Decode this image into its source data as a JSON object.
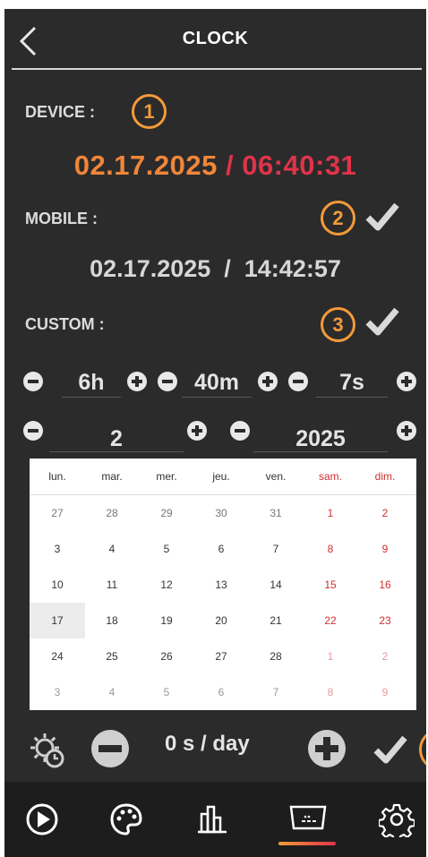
{
  "header": {
    "title": "CLOCK"
  },
  "device": {
    "label": "DEVICE :",
    "marker": "1",
    "date": "02.17.2025",
    "sep": " / ",
    "time": "06:40:31"
  },
  "mobile": {
    "label": "MOBILE :",
    "marker": "2",
    "datetime": "02.17.2025  /  14:42:57"
  },
  "custom": {
    "label": "CUSTOM :",
    "marker": "3",
    "hours": "6h",
    "minutes": "40m",
    "seconds": "7s",
    "month": "2",
    "year": "2025"
  },
  "calendar": {
    "weekdays": [
      "lun.",
      "mar.",
      "mer.",
      "jeu.",
      "ven.",
      "sam.",
      "dim."
    ],
    "weeks": [
      [
        "27",
        "28",
        "29",
        "30",
        "31",
        "1",
        "2"
      ],
      [
        "3",
        "4",
        "5",
        "6",
        "7",
        "8",
        "9"
      ],
      [
        "10",
        "11",
        "12",
        "13",
        "14",
        "15",
        "16"
      ],
      [
        "17",
        "18",
        "19",
        "20",
        "21",
        "22",
        "23"
      ],
      [
        "24",
        "25",
        "26",
        "27",
        "28",
        "1",
        "2"
      ],
      [
        "3",
        "4",
        "5",
        "6",
        "7",
        "8",
        "9"
      ]
    ],
    "selected": "17",
    "colors": {
      "weekend": "#d0302f",
      "muted": "#9a9a9a",
      "text": "#333333"
    }
  },
  "drift": {
    "rate": "0 s / day"
  },
  "colors": {
    "device_date": "#f0863a",
    "device_time": "#e0334a",
    "accent": "#f39a3a"
  },
  "nav": {
    "items": [
      "play-icon",
      "palette-icon",
      "bars-icon",
      "display-icon",
      "settings-icon"
    ],
    "active": "display-icon"
  }
}
